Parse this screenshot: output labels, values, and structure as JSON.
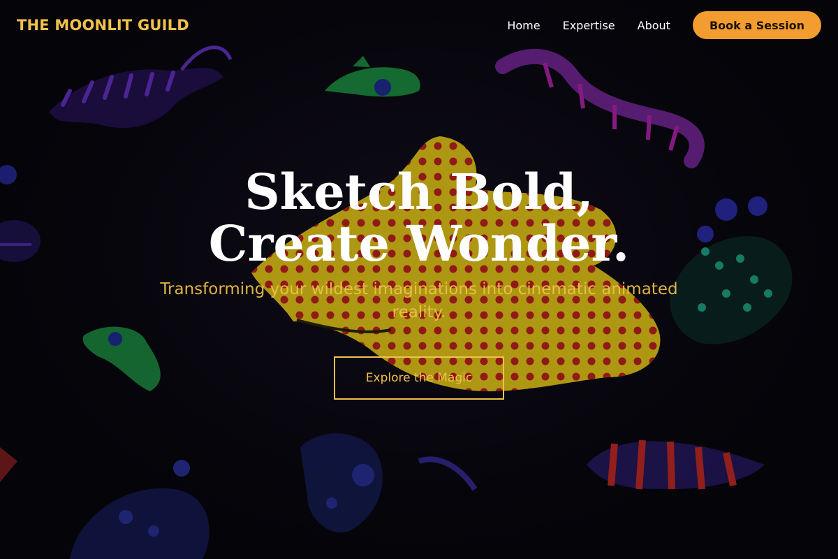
{
  "header": {
    "logo": "THE MOONLIT GUILD",
    "nav": [
      {
        "label": "Home"
      },
      {
        "label": "Expertise"
      },
      {
        "label": "About"
      }
    ],
    "cta_label": "Book a Session"
  },
  "hero": {
    "title": "Sketch Bold, Create Wonder.",
    "subtitle": "Transforming your wildest imaginations into cinematic animated reality.",
    "button_label": "Explore the Magic",
    "background_image": "neon-creatures-illustration"
  },
  "colors": {
    "accent_gold": "#f1c14a",
    "cta_orange": "#f39c2f",
    "background": "#07060d"
  }
}
